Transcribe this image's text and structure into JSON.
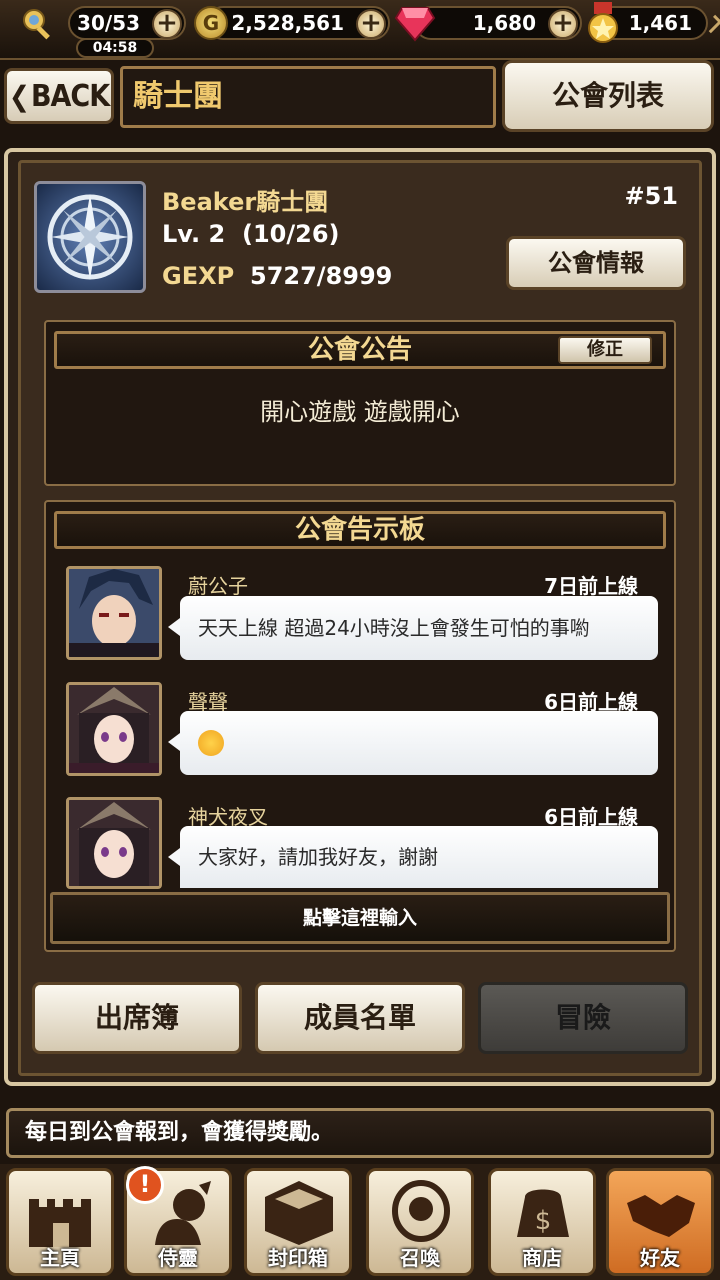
{
  "status": {
    "stamina": "30/53",
    "timer": "04:58",
    "gold": "2,528,561",
    "gems": "1,680",
    "medals": "1,461",
    "coin_letter": "G"
  },
  "header": {
    "back_label": "BACK",
    "title": "騎士團",
    "guild_list_label": "公會列表"
  },
  "guild": {
    "name": "Beaker騎士團",
    "level": "Lv. 2",
    "members": "(10/26)",
    "gexp_label": "GEXP",
    "gexp_value": "5727/8999",
    "rank": "#51",
    "info_button": "公會情報"
  },
  "announcement": {
    "title": "公會公告",
    "edit_label": "修正",
    "text": "開心遊戲 遊戲開心"
  },
  "board": {
    "title": "公會告示板",
    "posts": [
      {
        "name": "蔚公子",
        "time": "7日前上線",
        "message": "天天上線 超過24小時沒上會發生可怕的事喲"
      },
      {
        "name": "聲聲",
        "time": "6日前上線",
        "message": ""
      },
      {
        "name": "神犬夜叉",
        "time": "6日前上線",
        "message": "大家好，請加我好友，謝謝"
      }
    ],
    "input_placeholder": "點擊這裡輸入"
  },
  "actions": {
    "attendance": "出席簿",
    "members": "成員名單",
    "adventure": "冒險"
  },
  "notice": "每日到公會報到，會獲得獎勵。",
  "nav": {
    "items": [
      {
        "label": "主頁",
        "icon": "castle-icon"
      },
      {
        "label": "侍靈",
        "icon": "spirit-icon"
      },
      {
        "label": "封印箱",
        "icon": "seal-box-icon"
      },
      {
        "label": "召喚",
        "icon": "summon-icon"
      },
      {
        "label": "商店",
        "icon": "shop-icon"
      },
      {
        "label": "好友",
        "icon": "handshake-icon"
      }
    ],
    "alert": "!"
  },
  "colors": {
    "accent_gold": "#f3d892",
    "active_nav": "#e8893a",
    "alert": "#e0531f"
  }
}
